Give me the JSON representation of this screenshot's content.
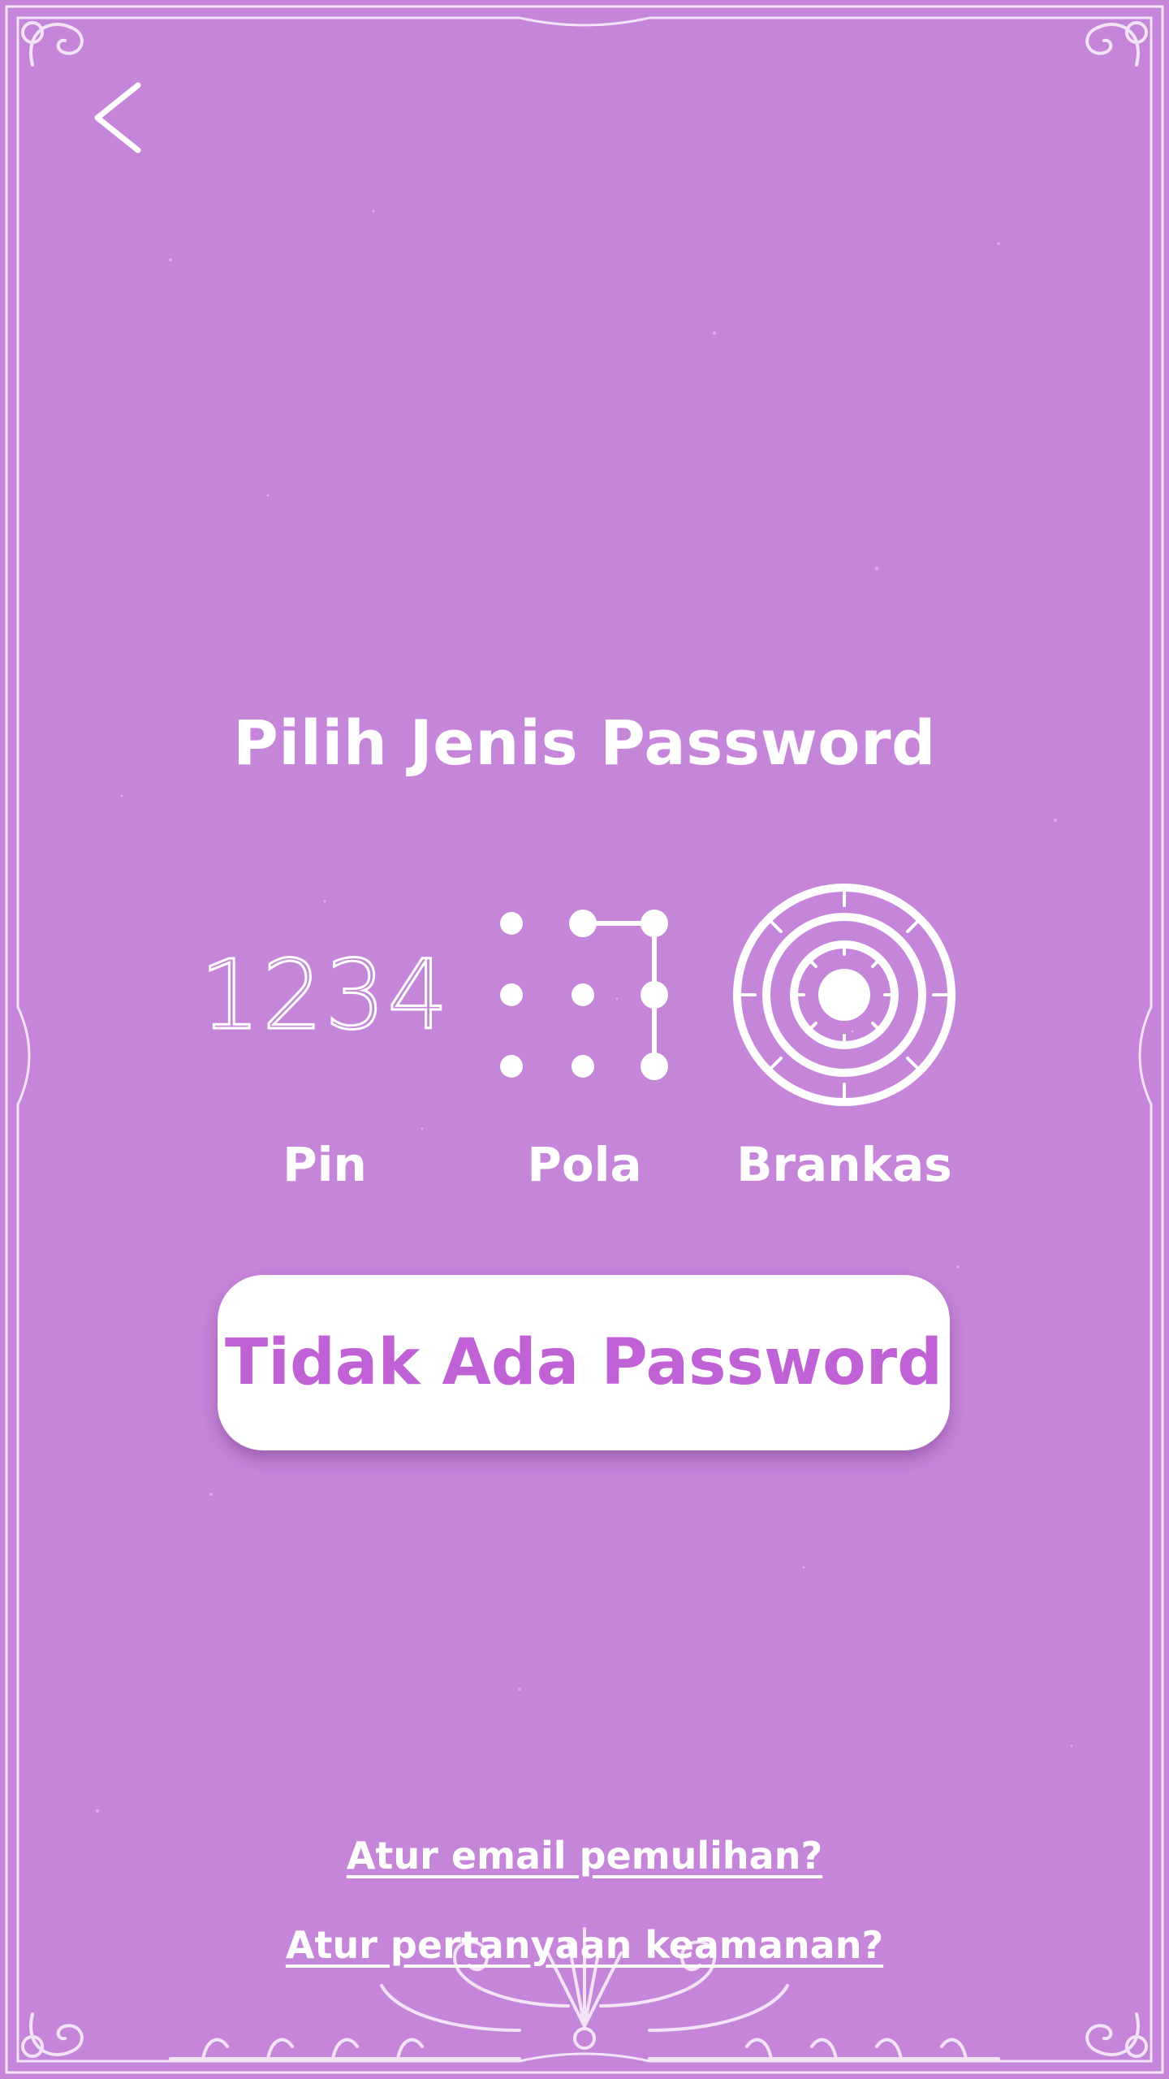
{
  "header": {
    "back_icon": "chevron-left-icon"
  },
  "title": "Pilih Jenis Password",
  "options": [
    {
      "id": "pin",
      "graphic_text": "1234",
      "label": "Pin",
      "icon": "pin-digits-icon"
    },
    {
      "id": "pola",
      "label": "Pola",
      "icon": "pattern-dots-icon"
    },
    {
      "id": "brankas",
      "label": "Brankas",
      "icon": "safe-dial-icon"
    }
  ],
  "no_password_button": "Tidak Ada Password",
  "links": {
    "recovery_email": "Atur email pemulihan?",
    "security_question": "Atur pertanyaan keamanan?"
  },
  "colors": {
    "background": "#c585d9",
    "accent": "#c062d6",
    "foreground": "#ffffff"
  }
}
